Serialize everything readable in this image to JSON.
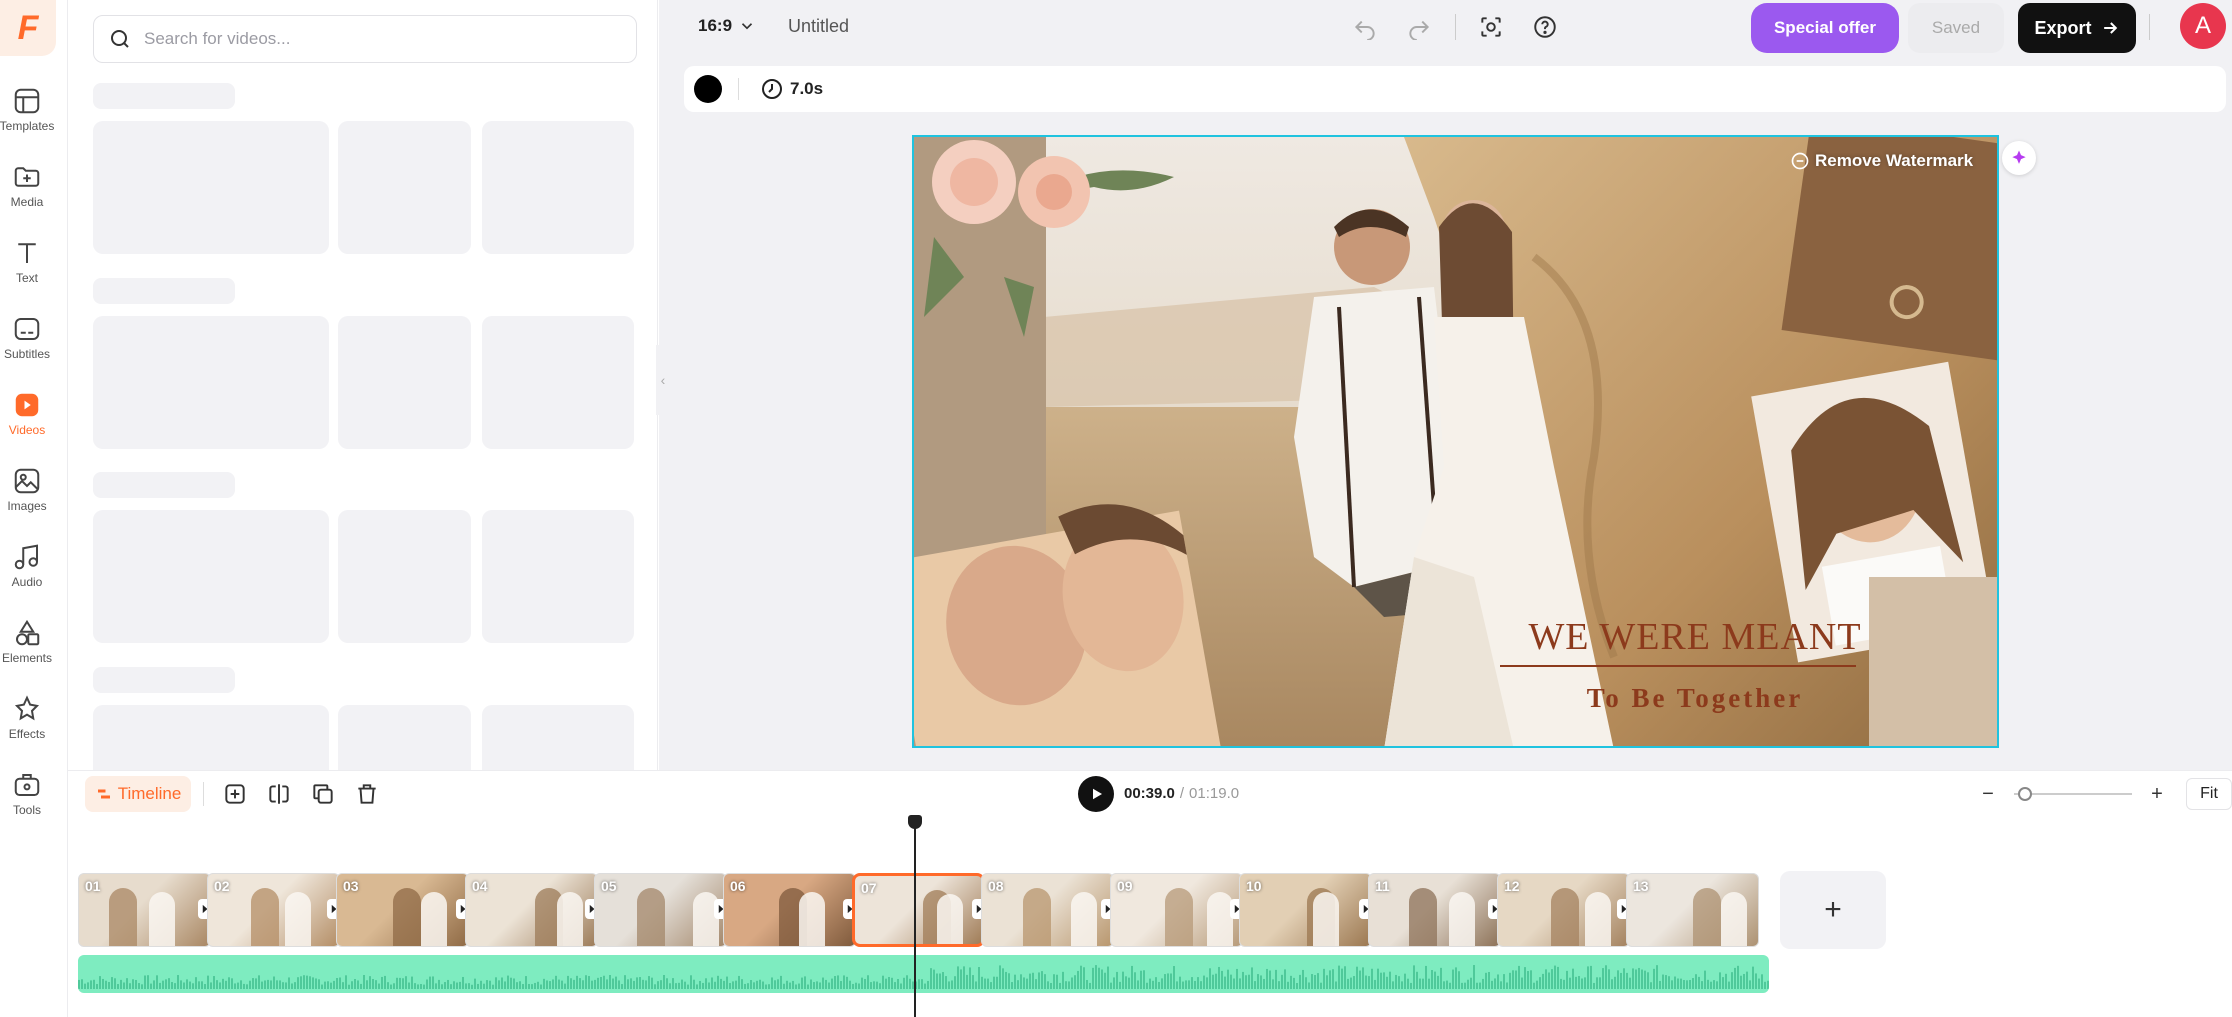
{
  "rail": {
    "logo": "F",
    "items": [
      {
        "label": "Templates",
        "icon": "templates-icon"
      },
      {
        "label": "Media",
        "icon": "media-icon"
      },
      {
        "label": "Text",
        "icon": "text-icon"
      },
      {
        "label": "Subtitles",
        "icon": "subtitles-icon"
      },
      {
        "label": "Videos",
        "icon": "videos-icon",
        "active": true
      },
      {
        "label": "Images",
        "icon": "images-icon"
      },
      {
        "label": "Audio",
        "icon": "audio-icon"
      },
      {
        "label": "Elements",
        "icon": "elements-icon"
      },
      {
        "label": "Effects",
        "icon": "effects-icon"
      },
      {
        "label": "Tools",
        "icon": "tools-icon"
      }
    ]
  },
  "panel": {
    "search_placeholder": "Search for videos..."
  },
  "topbar": {
    "aspect_ratio": "16:9",
    "project_title": "Untitled",
    "special_offer": "Special offer",
    "saved": "Saved",
    "export": "Export",
    "avatar_letter": "A"
  },
  "canvas_toolbar": {
    "duration": "7.0s",
    "color": "#000000"
  },
  "canvas": {
    "remove_watermark": "Remove Watermark",
    "headline": "WE WERE MEANT",
    "subline": "To Be Together"
  },
  "timeline": {
    "label": "Timeline",
    "current_time": "00:39.0",
    "separator": "/",
    "total_time": "01:19.0",
    "fit": "Fit",
    "zoom_fraction": 0.05,
    "add_symbol": "+",
    "clips": [
      "01",
      "02",
      "03",
      "04",
      "05",
      "06",
      "07",
      "08",
      "09",
      "10",
      "11",
      "12",
      "13"
    ],
    "selected_clip": "07"
  },
  "colors": {
    "accent": "#ff6a2a",
    "special_offer": "#9b59ef",
    "export_bg": "#111111",
    "avatar": "#e8364e",
    "selection": "#1fc3df",
    "audio_wave": "#7eecc0",
    "headline": "#8c3a1c"
  }
}
